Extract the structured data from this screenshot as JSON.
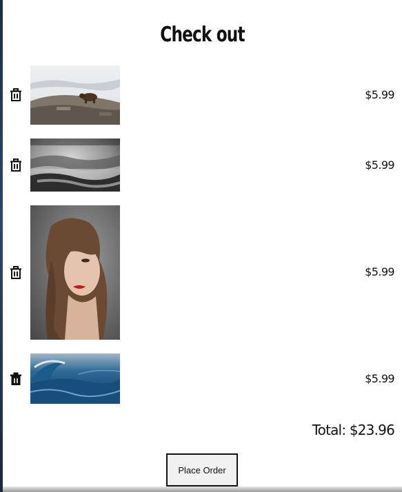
{
  "checkout": {
    "title": "Check out",
    "items": [
      {
        "image": "bear-on-rocky-hill",
        "price": "$5.99",
        "trash_icon": "trash-outline-icon"
      },
      {
        "image": "misty-forest-mountains",
        "price": "$5.99",
        "trash_icon": "trash-outline-icon"
      },
      {
        "image": "woman-portrait-red-lips",
        "price": "$5.99",
        "trash_icon": "trash-outline-icon"
      },
      {
        "image": "ocean-wave",
        "price": "$5.99",
        "trash_icon": "trash-filled-icon"
      }
    ],
    "total_label": "Total: $23.96",
    "place_order_label": "Place Order"
  }
}
